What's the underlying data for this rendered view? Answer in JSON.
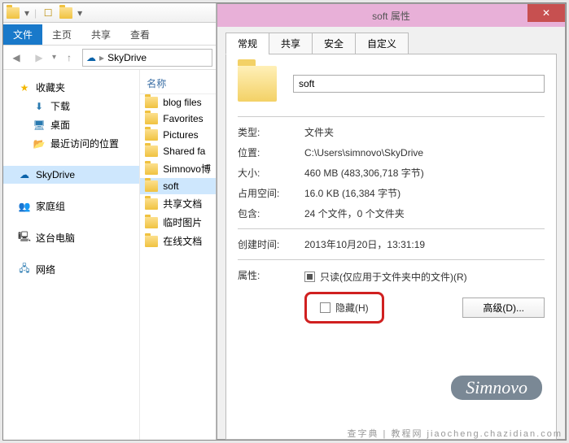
{
  "explorer": {
    "ribbon": {
      "file": "文件",
      "home": "主页",
      "share": "共享",
      "view": "查看"
    },
    "breadcrumb": {
      "root": "SkyDrive"
    },
    "nav": {
      "favorites": {
        "label": "收藏夹",
        "downloads": "下载",
        "desktop": "桌面",
        "recent": "最近访问的位置"
      },
      "skydrive": "SkyDrive",
      "homegroup": "家庭组",
      "thispc": "这台电脑",
      "network": "网络"
    },
    "column_header": "名称",
    "files": [
      "blog files",
      "Favorites",
      "Pictures",
      "Shared fa",
      "Simnovo博",
      "soft",
      "共享文档",
      "临时图片",
      "在线文档"
    ]
  },
  "props": {
    "title": "soft 属性",
    "tabs": {
      "general": "常规",
      "sharing": "共享",
      "security": "安全",
      "customize": "自定义"
    },
    "name_value": "soft",
    "type": {
      "label": "类型:",
      "value": "文件夹"
    },
    "location": {
      "label": "位置:",
      "value": "C:\\Users\\simnovo\\SkyDrive"
    },
    "size": {
      "label": "大小:",
      "value": "460 MB (483,306,718 字节)"
    },
    "size_on_disk": {
      "label": "占用空间:",
      "value": "16.0 KB (16,384 字节)"
    },
    "contains": {
      "label": "包含:",
      "value": "24 个文件，0 个文件夹"
    },
    "created": {
      "label": "创建时间:",
      "value": "2013年10月20日，13:31:19"
    },
    "attributes_label": "属性:",
    "readonly_label": "只读(仅应用于文件夹中的文件)(R)",
    "hidden_label": "隐藏(H)",
    "advanced_button": "高级(D)..."
  },
  "watermark": "Simnovo",
  "footer": "查字典 | 教程网  jiaocheng.chazidian.com"
}
